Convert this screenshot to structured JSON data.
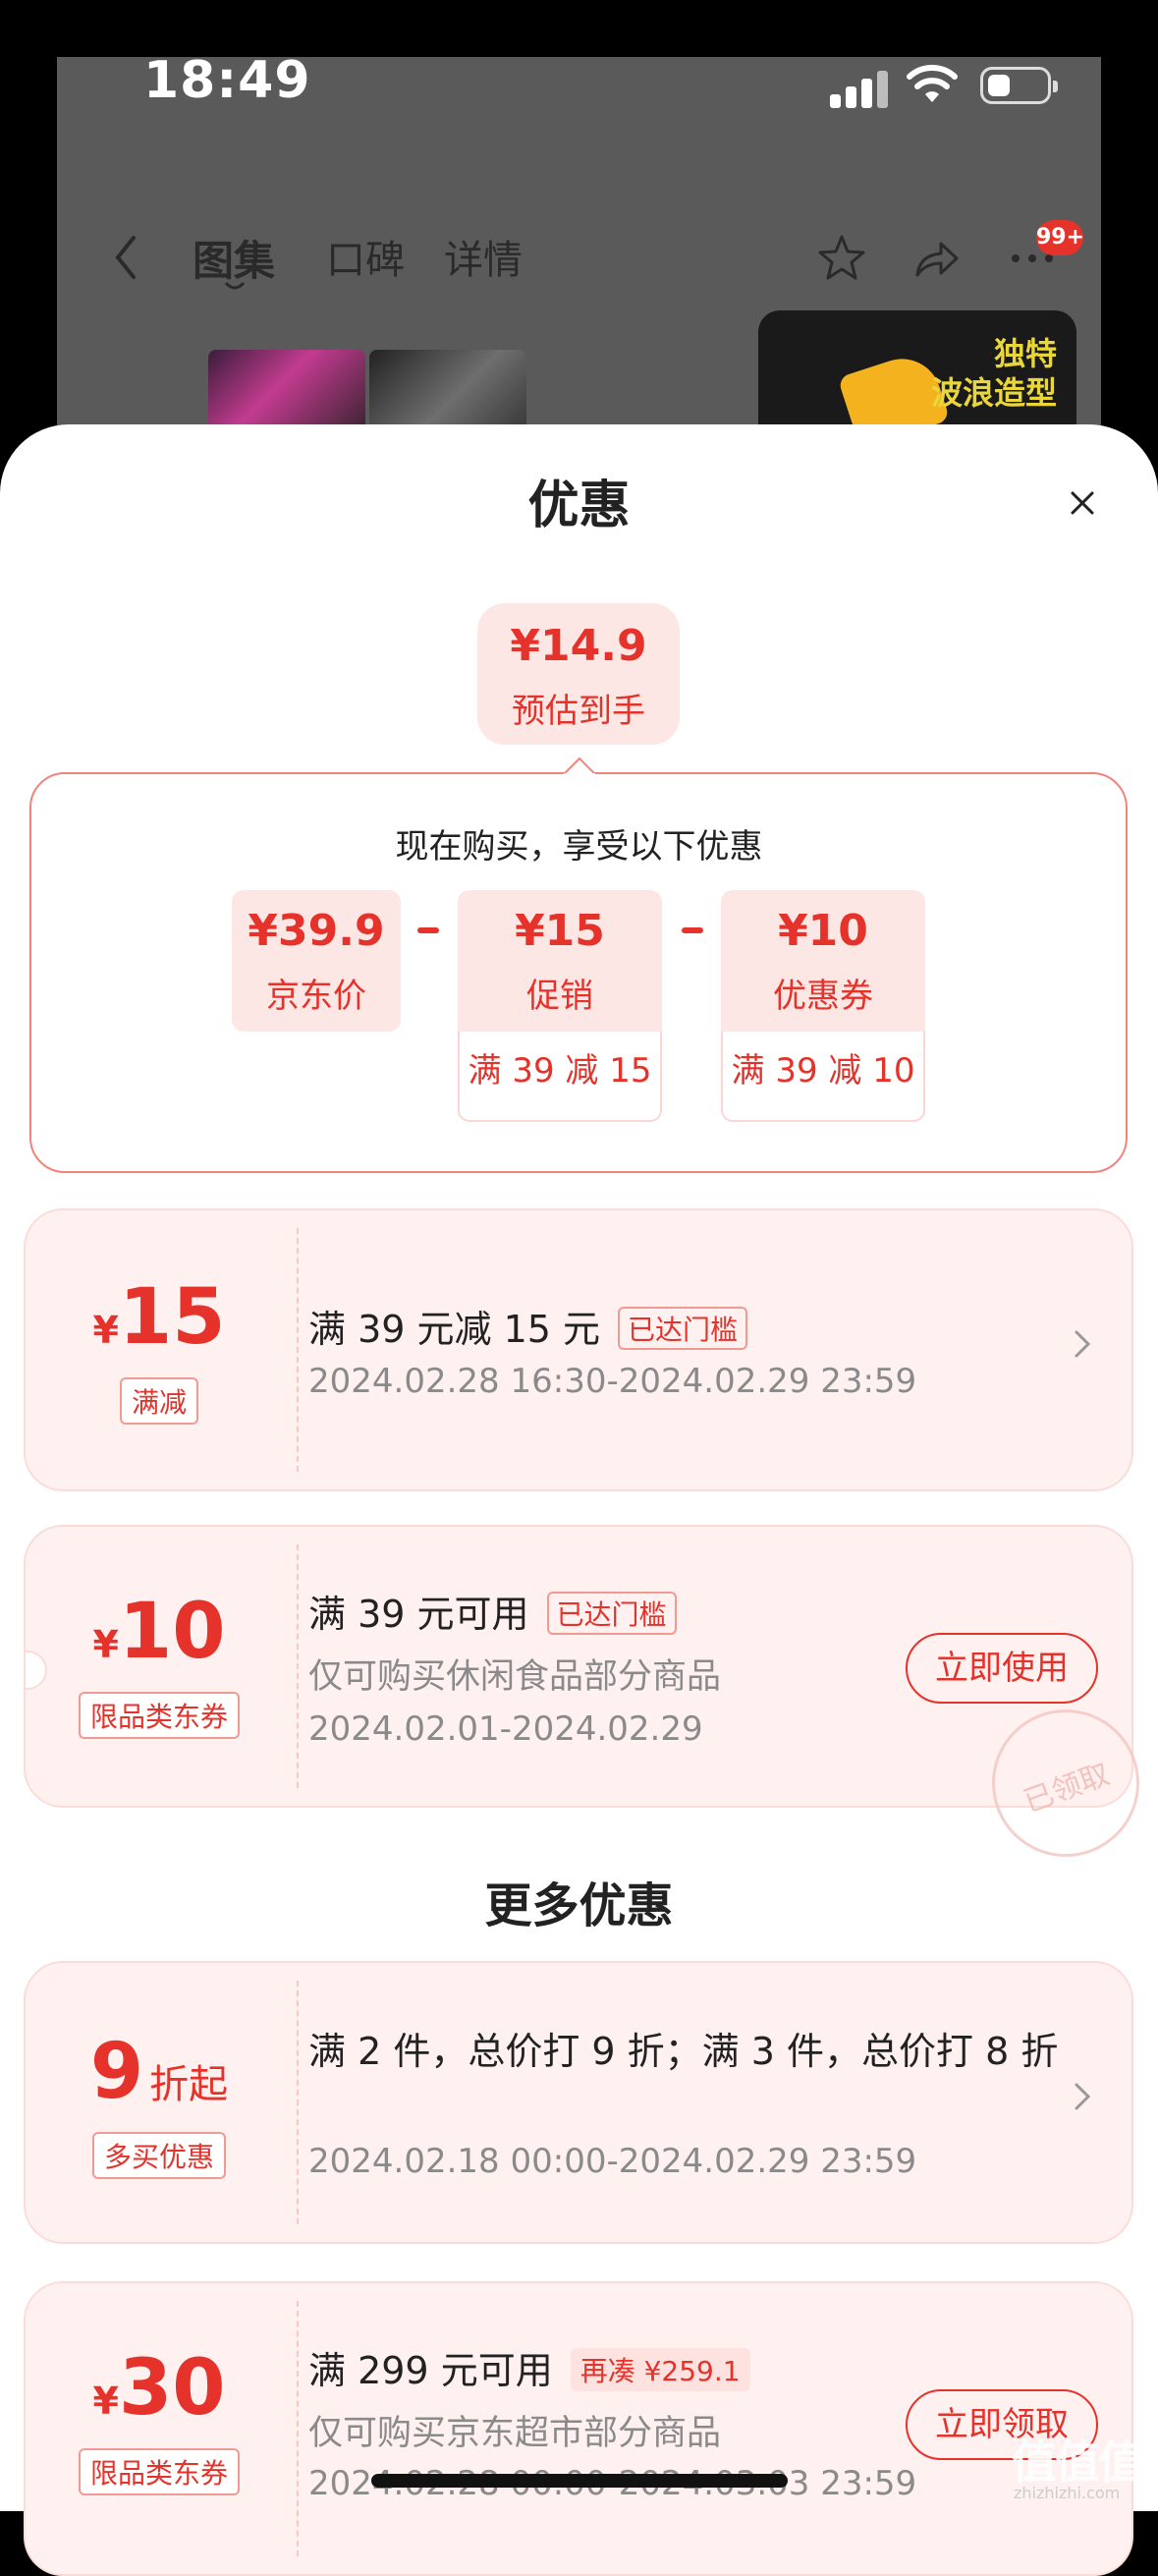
{
  "status": {
    "time": "18:49"
  },
  "nav": {
    "tabs": [
      {
        "label": "图集"
      },
      {
        "label": "口碑"
      },
      {
        "label": "详情"
      }
    ],
    "badge": "99+"
  },
  "promo_image": {
    "text_line1": "独特",
    "text_line2": "波浪造型"
  },
  "sheet": {
    "title": "优惠",
    "estimate": {
      "price": "¥14.9",
      "label": "预估到手"
    },
    "summary": {
      "title": "现在购买，享受以下优惠",
      "items": [
        {
          "amount": "¥39.9",
          "label": "京东价",
          "sub": ""
        },
        {
          "amount": "¥15",
          "label": "促销",
          "sub": "满 39 减 15"
        },
        {
          "amount": "¥10",
          "label": "优惠券",
          "sub": "满 39 减 10"
        }
      ]
    },
    "coupons": [
      {
        "yen": "¥",
        "amount": "15",
        "tag": "满减",
        "title": "满 39 元减 15 元",
        "badge": "已达门槛",
        "date": "2024.02.28 16:30-2024.02.29 23:59"
      },
      {
        "yen": "¥",
        "amount": "10",
        "tag": "限品类东券",
        "title": "满 39 元可用",
        "badge": "已达门槛",
        "desc": "仅可购买休闲食品部分商品",
        "date": "2024.02.01-2024.02.29",
        "button": "立即使用",
        "stamp": "已领取"
      }
    ],
    "more_title": "更多优惠",
    "more": [
      {
        "amount": "9",
        "unit": "折起",
        "tag": "多买优惠",
        "title": "满 2 件，总价打 9 折；满 3 件，总价打 8 折",
        "date": "2024.02.18 00:00-2024.02.29 23:59"
      },
      {
        "yen": "¥",
        "amount": "30",
        "tag": "限品类东券",
        "title": "满 299 元可用",
        "badge": "再凑 ¥259.1",
        "desc": "仅可购买京东超市部分商品",
        "date": "2024.02.28 00:00-2024.03.03 23:59",
        "button": "立即领取"
      }
    ]
  },
  "watermark": {
    "text": "值值值",
    "sub": "zhizhizhi.com"
  }
}
